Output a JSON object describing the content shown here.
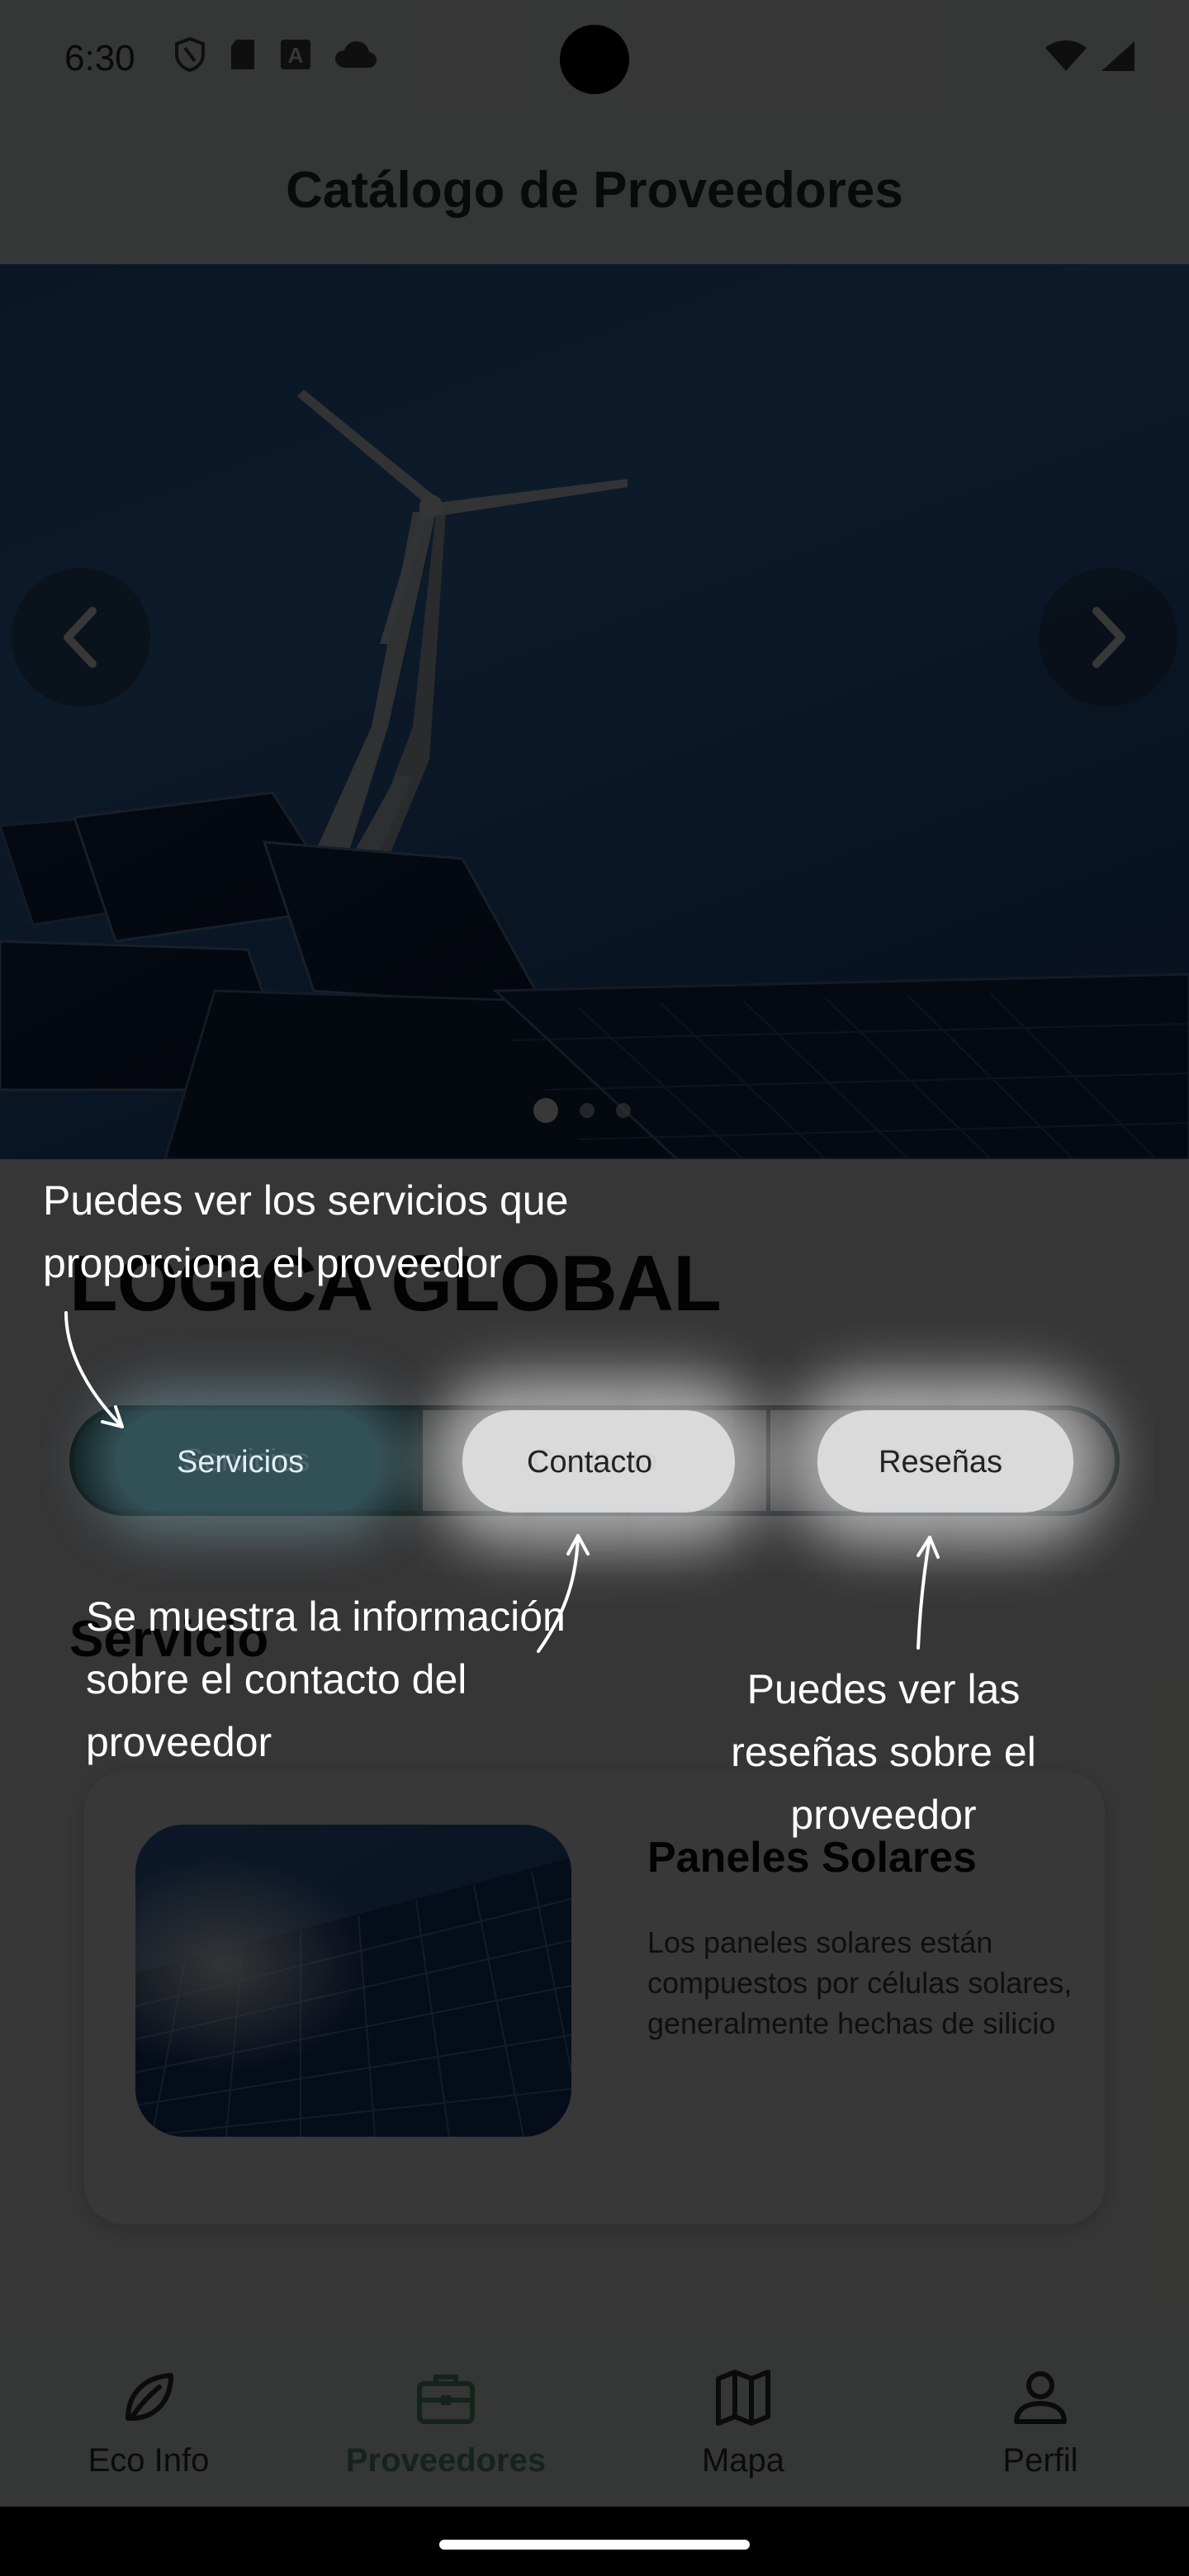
{
  "status_bar": {
    "time": "6:30"
  },
  "app_bar": {
    "title": "Catálogo de Proveedores"
  },
  "provider": {
    "name": "LOGICA GLOBAL"
  },
  "tabs": [
    {
      "label": "Servicios",
      "active": true
    },
    {
      "label": "Contacto",
      "active": false
    },
    {
      "label": "Reseñas",
      "active": false
    }
  ],
  "services_section": {
    "title": "Servicio"
  },
  "service_card": {
    "name": "Paneles Solares",
    "description": "Los paneles solares están compuestos por células solares, generalmente hechas de silicio"
  },
  "carousel": {
    "slide_count": 3,
    "active_slide": 1
  },
  "bottom_nav": [
    {
      "label": "Eco Info",
      "icon": "leaf-icon",
      "active": false
    },
    {
      "label": "Proveedores",
      "icon": "briefcase-icon",
      "active": true
    },
    {
      "label": "Mapa",
      "icon": "map-icon",
      "active": false
    },
    {
      "label": "Perfil",
      "icon": "person-icon",
      "active": false
    }
  ],
  "tutorial": {
    "servicios_tip": "Puedes ver los servicios que proporciona el proveedor",
    "contacto_tip": "Se muestra la información sobre el contacto del proveedor",
    "resenas_tip": "Puedes ver las reseñas sobre el proveedor"
  },
  "colors": {
    "accent_green": "#5aa37a",
    "tab_border": "#2f5b57",
    "overlay": "#000000"
  }
}
